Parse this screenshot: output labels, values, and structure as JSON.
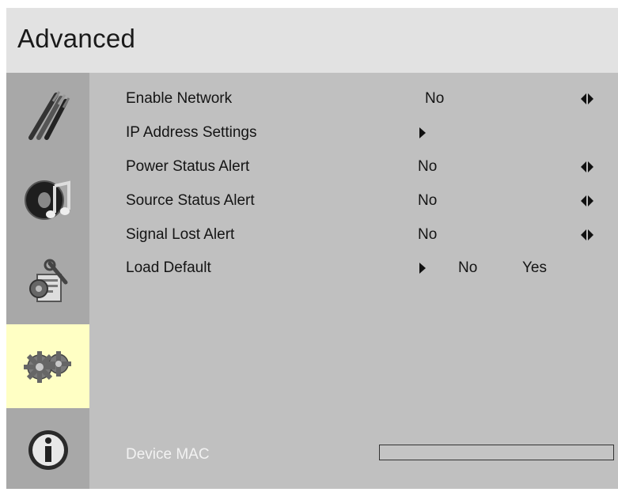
{
  "title": "Advanced",
  "sidebar": {
    "items": [
      {
        "icon": "cables-icon",
        "active": false
      },
      {
        "icon": "audio-icon",
        "active": false
      },
      {
        "icon": "settings-tools-icon",
        "active": false
      },
      {
        "icon": "gears-icon",
        "active": true
      },
      {
        "icon": "info-icon",
        "active": false
      }
    ]
  },
  "menu": {
    "enable_network": {
      "label": "Enable Network",
      "value": "No"
    },
    "ip_settings": {
      "label": "IP Address Settings"
    },
    "power_alert": {
      "label": "Power Status Alert",
      "value": "No"
    },
    "source_alert": {
      "label": "Source Status Alert",
      "value": "No"
    },
    "signal_alert": {
      "label": "Signal Lost Alert",
      "value": "No"
    },
    "load_default": {
      "label": "Load Default",
      "no": "No",
      "yes": "Yes"
    }
  },
  "device_mac": {
    "label": "Device MAC",
    "value": ""
  },
  "colors": {
    "title_bg": "#e2e2e2",
    "panel_bg": "#c0c0c0",
    "sidebar_bg": "#a8a8a8",
    "active_bg": "#ffffc4"
  }
}
